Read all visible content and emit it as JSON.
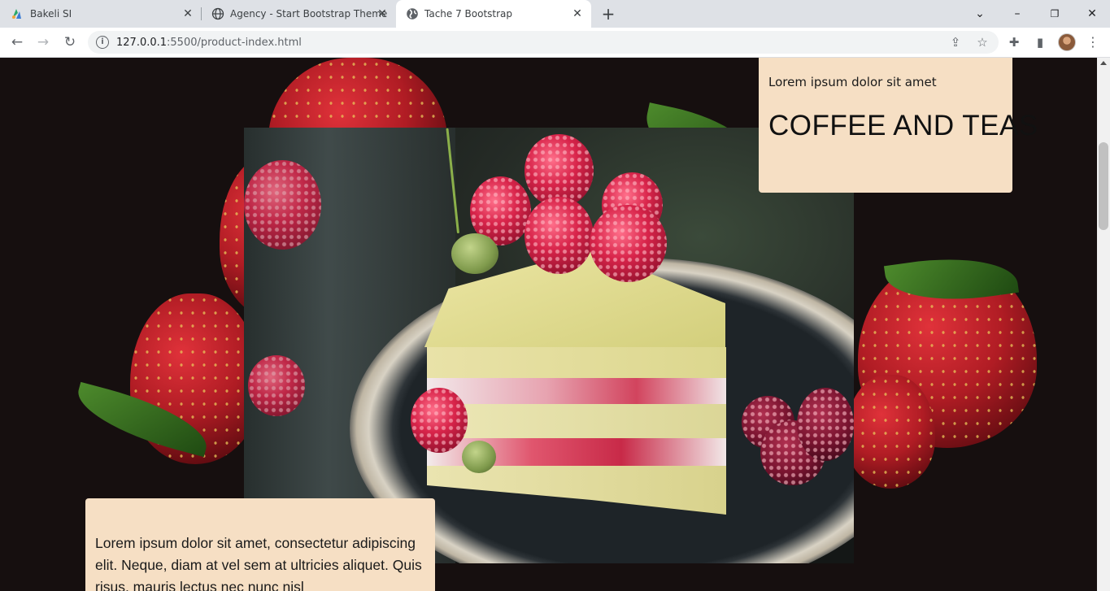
{
  "browser": {
    "tabs": [
      {
        "title": "Bakeli SI",
        "icon": "bakeli-logo-icon",
        "active": false
      },
      {
        "title": "Agency - Start Bootstrap Theme",
        "icon": "globe-icon",
        "active": false
      },
      {
        "title": "Tache 7 Bootstrap",
        "icon": "globe-icon",
        "active": true
      }
    ],
    "url_host": "127.0.0.1",
    "url_path": ":5500/product-index.html"
  },
  "page": {
    "top_panel": {
      "kicker": "Lorem ipsum dolor sit amet",
      "heading": "COFFEE AND TEAS"
    },
    "bottom_panel": {
      "paragraph": "Lorem ipsum dolor sit amet, consectetur adipiscing elit. Neque, diam at vel sem at ultricies aliquet. Quis risus, mauris lectus nec nunc nisl"
    }
  },
  "colors": {
    "page_background": "#160f0f",
    "panel_background": "#f6dfc4",
    "tab_strip": "#dee1e6"
  }
}
